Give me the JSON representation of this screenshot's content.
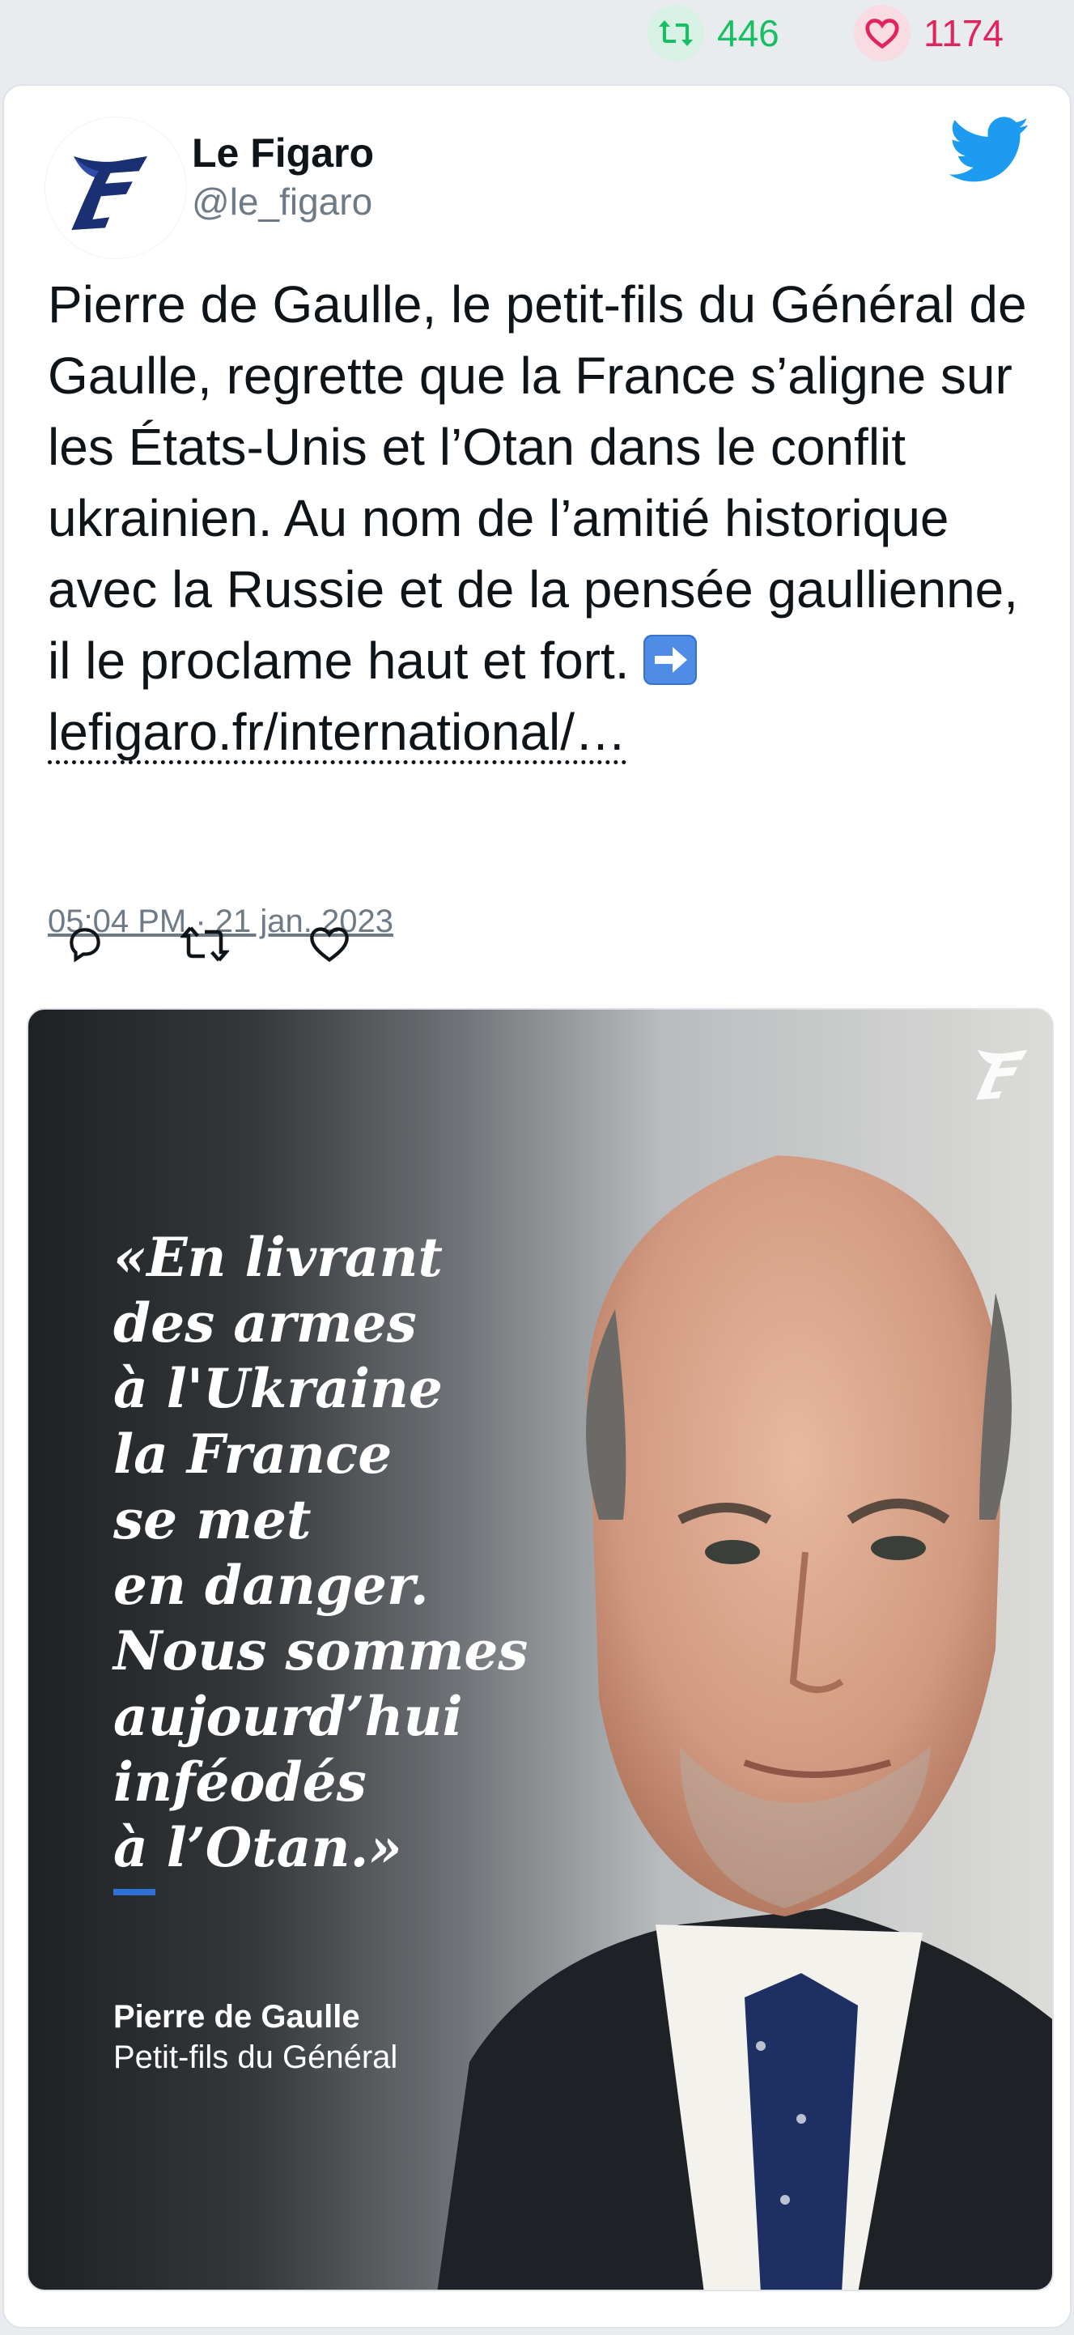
{
  "stats": {
    "retweet_count": "446",
    "like_count": "1174",
    "retweet_icon": "retweet-icon",
    "like_icon": "heart-icon",
    "retweet_color": "#17bf63",
    "like_color": "#e0245e"
  },
  "tweet": {
    "author_name": "Le Figaro",
    "author_handle": "@le_figaro",
    "avatar_logo_text": "F",
    "platform_icon": "twitter-bird-icon",
    "text": "Pierre de Gaulle, le petit-fils du Général de Gaulle, regrette que la France s’aligne sur les États-Unis et l’Otan dans le conflit ukrainien. Au nom de l’amitié historique avec la Russie et de la pensée gaullienne, il le proclame haut et fort.",
    "emoji": "right-arrow-emoji",
    "link_text": "lefigaro.fr/international/…",
    "timestamp": "05:04 PM · 21 jan. 2023",
    "accent_color": "#1d9bf0"
  },
  "actions": {
    "reply_icon": "reply-icon",
    "retweet_icon": "retweet-icon",
    "like_icon": "heart-icon"
  },
  "media": {
    "quote": "«En livrant\ndes armes\nà l'Ukraine\nla France\nse met\nen danger.\nNous sommes\naujourd’hui\ninféodés\nà l’Otan.»",
    "speaker_name": "Pierre de Gaulle",
    "speaker_role": "Petit-fils du Général",
    "watermark_text": "F",
    "quote_bar_color": "#2f6fd6"
  }
}
